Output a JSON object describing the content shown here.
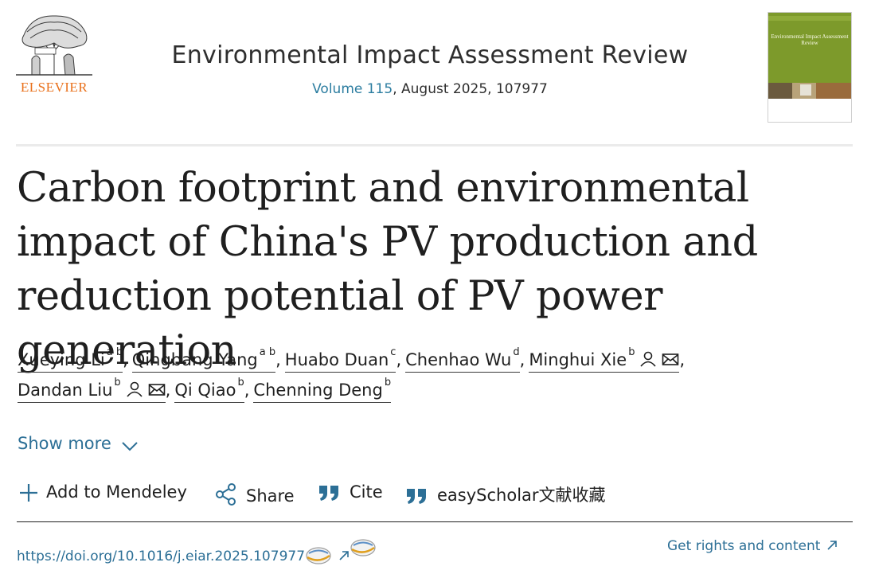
{
  "header": {
    "publisher_logo_text": "ELSEVIER",
    "journal_title": "Environmental Impact Assessment Review",
    "volume_label": "Volume 115",
    "issue_rest": ", August 2025, 107977",
    "cover_text": "Environmental Impact Assessment Review"
  },
  "article": {
    "title": "Carbon footprint and environmental impact of China's PV production and reduction potential of PV power generation"
  },
  "authors": [
    {
      "name": "Xueying Li",
      "aff": "a b"
    },
    {
      "name": "Qingbang Yang",
      "aff": "a b"
    },
    {
      "name": "Huabo Duan",
      "aff": "c"
    },
    {
      "name": "Chenhao Wu",
      "aff": "d"
    },
    {
      "name": "Minghui Xie",
      "aff": "b"
    },
    {
      "name": "Dandan Liu",
      "aff": "b"
    },
    {
      "name": "Qi Qiao",
      "aff": "b"
    },
    {
      "name": "Chenning Deng",
      "aff": "b"
    }
  ],
  "punct": {
    "comma": ","
  },
  "show_more": "Show more",
  "actions": {
    "mendeley": "Add to Mendeley",
    "share": "Share",
    "cite": "Cite",
    "easyscholar": "easyScholar文献收藏"
  },
  "links": {
    "doi": "https://doi.org/10.1016/j.eiar.2025.107977",
    "rights": "Get rights and content"
  },
  "colors": {
    "link": "#2c6f96",
    "volume": "#2c7da0",
    "elsevier_orange": "#e9711c",
    "cover_green": "#7d9a2b"
  }
}
